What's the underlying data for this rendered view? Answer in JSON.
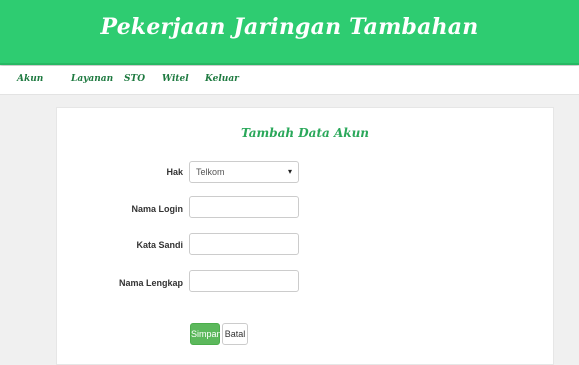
{
  "header": {
    "title": "Pekerjaan Jaringan Tambahan"
  },
  "nav": {
    "items": [
      "Akun",
      "Layanan",
      "STO",
      "Witel",
      "Keluar"
    ]
  },
  "form": {
    "title": "Tambah Data Akun",
    "hak_label": "Hak",
    "hak_value": "Telkom",
    "nama_login_label": "Nama Login",
    "nama_login_value": "",
    "kata_sandi_label": "Kata Sandi",
    "kata_sandi_value": "",
    "nama_lengkap_label": "Nama Lengkap",
    "nama_lengkap_value": "",
    "save_label": "Simpan",
    "cancel_label": "Batal"
  },
  "icons": {
    "select_caret": "chevron-down-icon"
  },
  "colors": {
    "accent": "#2ecc71",
    "save_button": "#5cb85c"
  }
}
